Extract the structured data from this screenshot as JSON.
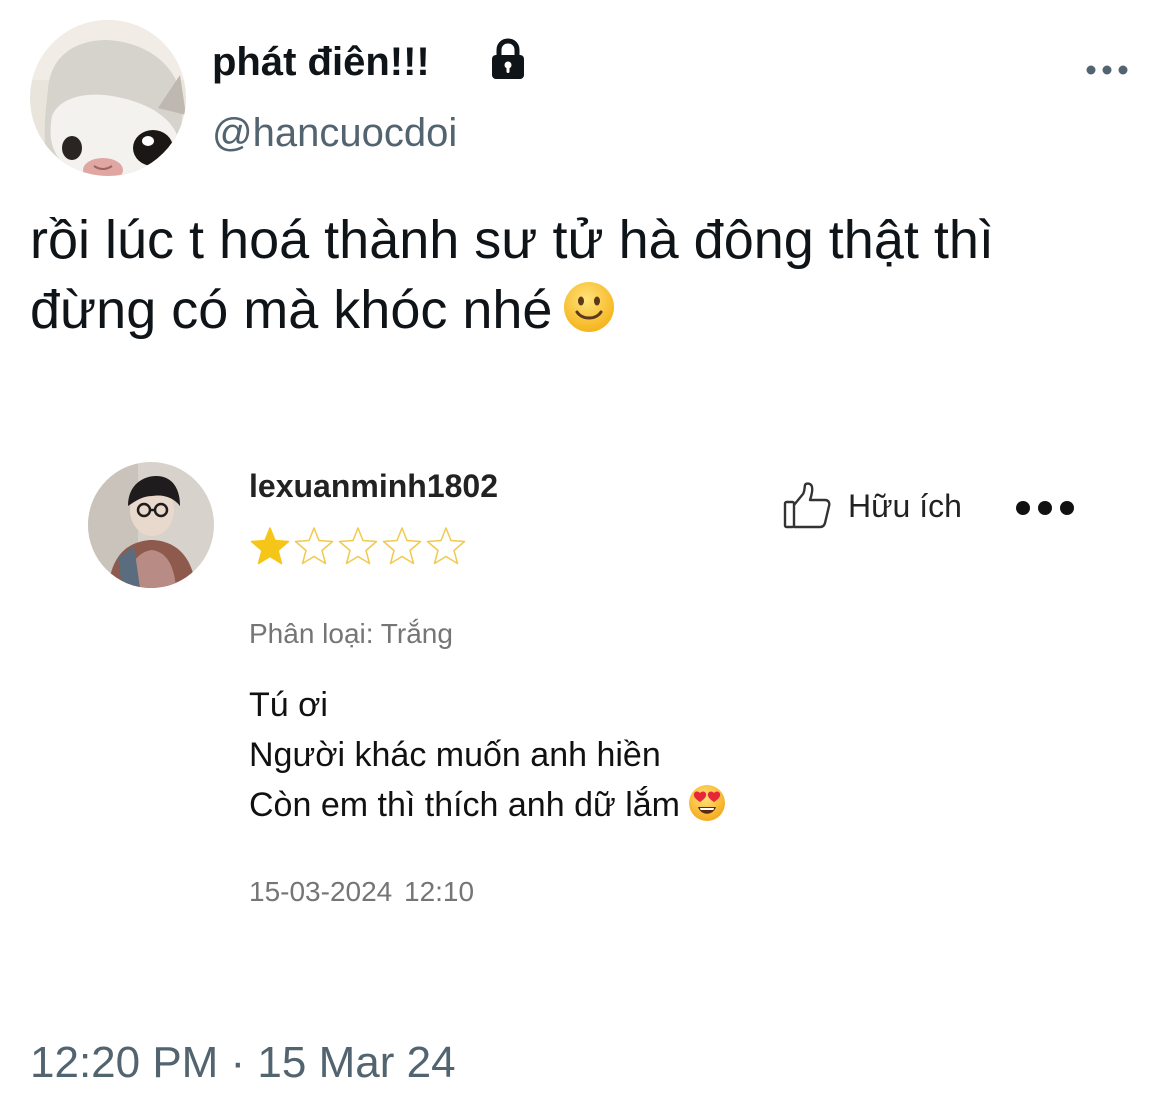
{
  "tweet": {
    "author": {
      "display_name": "phát điên!!!",
      "handle": "@hancuocdoi",
      "protected_icon": "lock-icon",
      "avatar": "cat-avatar"
    },
    "more_icon": "more-horizontal-icon",
    "text_lines": [
      "rồi lúc t hoá thành sư tử hà đông thật thì",
      "đừng có mà khóc nhé"
    ],
    "emoji": "slightly-smiling-face",
    "timestamp": "12:20 PM · 15 Mar 24"
  },
  "review": {
    "reviewer": "lexuanminh1802",
    "rating": 1,
    "max_rating": 5,
    "helpful_label": "Hữu ích",
    "helpful_icon": "thumbs-up-icon",
    "more_icon": "more-dots-icon",
    "variant": "Phân loại: Trắng",
    "body_lines": [
      "Tú ơi",
      "Người khác muốn anh hiền",
      "Còn em thì thích anh dữ lắm"
    ],
    "body_emoji": "smiling-face-with-heart-eyes",
    "date": "15-03-2024 12:10"
  },
  "colors": {
    "star_filled": "#f5c518",
    "star_outline": "#f2c94c",
    "muted_text": "#536471",
    "review_muted": "#757575"
  }
}
